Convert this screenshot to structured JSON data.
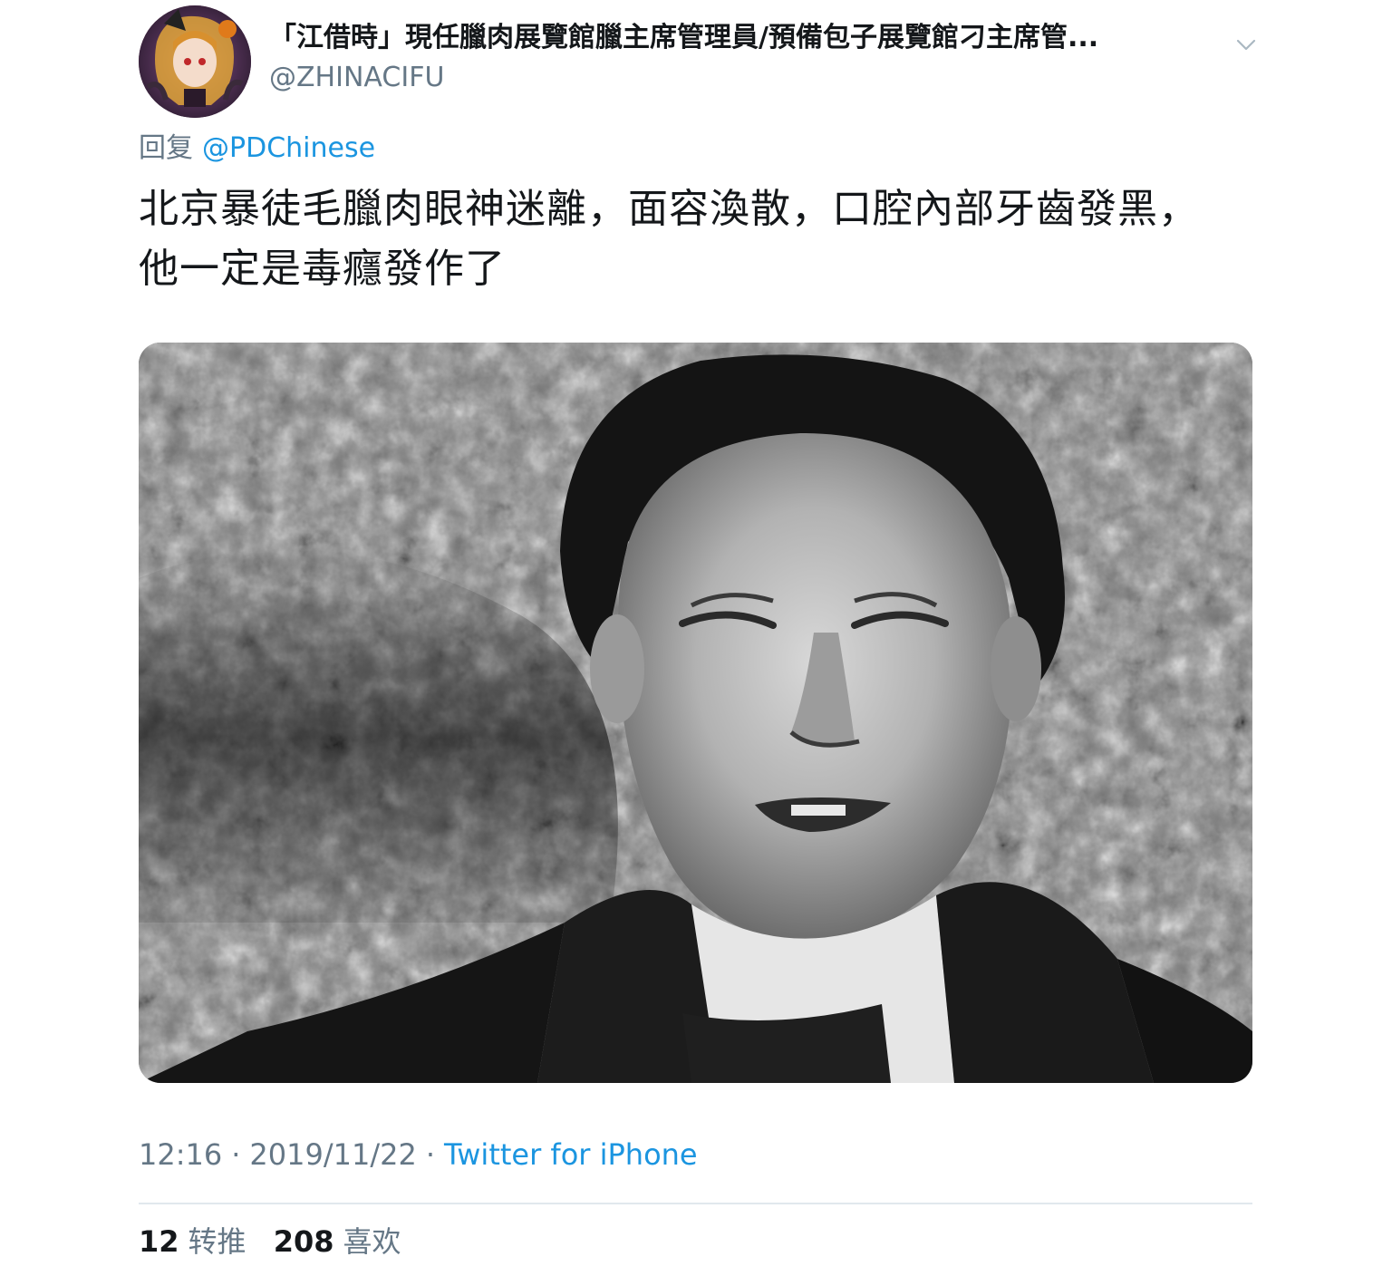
{
  "user": {
    "display_name": "「江借時」現任臘肉展覽館臘主席管理員/預備包子展覽館刁主席管...",
    "handle": "@ZHINACIFU",
    "avatar_icon": "user-avatar-image"
  },
  "reply": {
    "prefix": "回复",
    "mention": "@PDChinese"
  },
  "tweet": {
    "text": "北京暴徒毛臘肉眼神迷離，面容渙散，口腔內部牙齒發黑，他一定是毒癮發作了"
  },
  "media": {
    "kind": "black-and-white portrait photo"
  },
  "meta": {
    "time": "12:16",
    "separator": "·",
    "date": "2019/11/22",
    "source": "Twitter for iPhone"
  },
  "stats": {
    "retweets_count": "12",
    "retweets_label": "转推",
    "likes_count": "208",
    "likes_label": "喜欢"
  },
  "icons": {
    "caret": "chevron-down-icon"
  },
  "colors": {
    "link": "#1b95e0",
    "secondary_text": "#657786",
    "primary_text": "#14171a",
    "divider": "#e1e8ed"
  }
}
